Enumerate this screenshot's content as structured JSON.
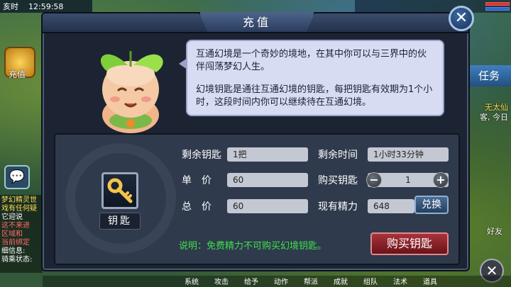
{
  "hud": {
    "time": "12:59:58",
    "period": "亥时"
  },
  "side": {
    "recharge_label": "充值",
    "task_label": "任务",
    "friend_label": "好友"
  },
  "chat_log": [
    "梦幻精灵世",
    "戏有任何疑",
    "它迎说",
    "这不来进",
    "区域和",
    "当前绑定",
    "细信息:",
    "骑乘状态:"
  ],
  "right_text": [
    "无太仙",
    "客, 今日"
  ],
  "bottom_bar": [
    "系统",
    "攻击",
    "给予",
    "动作",
    "帮派",
    "成就",
    "组队",
    "法术",
    "道具"
  ],
  "dialog": {
    "title": "充值",
    "intro_p1": "互通幻境是一个奇妙的境地，在其中你可以与三界中的伙伴闯荡梦幻人生。",
    "intro_p2": "幻境钥匙是通往互通幻境的钥匙，每把钥匙有效期为1个小时，这段时间内你可以继续待在互通幻境。",
    "item_label": "钥匙",
    "fields": {
      "remaining_keys_label": "剩余钥匙",
      "remaining_keys_value": "1把",
      "remaining_time_label": "剩余时间",
      "remaining_time_value": "1小时33分钟",
      "unit_price_label": "单　价",
      "unit_price_value": "60",
      "buy_keys_label": "购买钥匙",
      "buy_keys_value": "1",
      "total_price_label": "总　价",
      "total_price_value": "60",
      "current_energy_label": "现有精力",
      "current_energy_value": "648"
    },
    "exchange_label": "兑换",
    "hint": "说明：免费精力不可购买幻境钥匙。",
    "buy_button": "购买钥匙",
    "minus": "−",
    "plus": "+",
    "close": "✕"
  }
}
